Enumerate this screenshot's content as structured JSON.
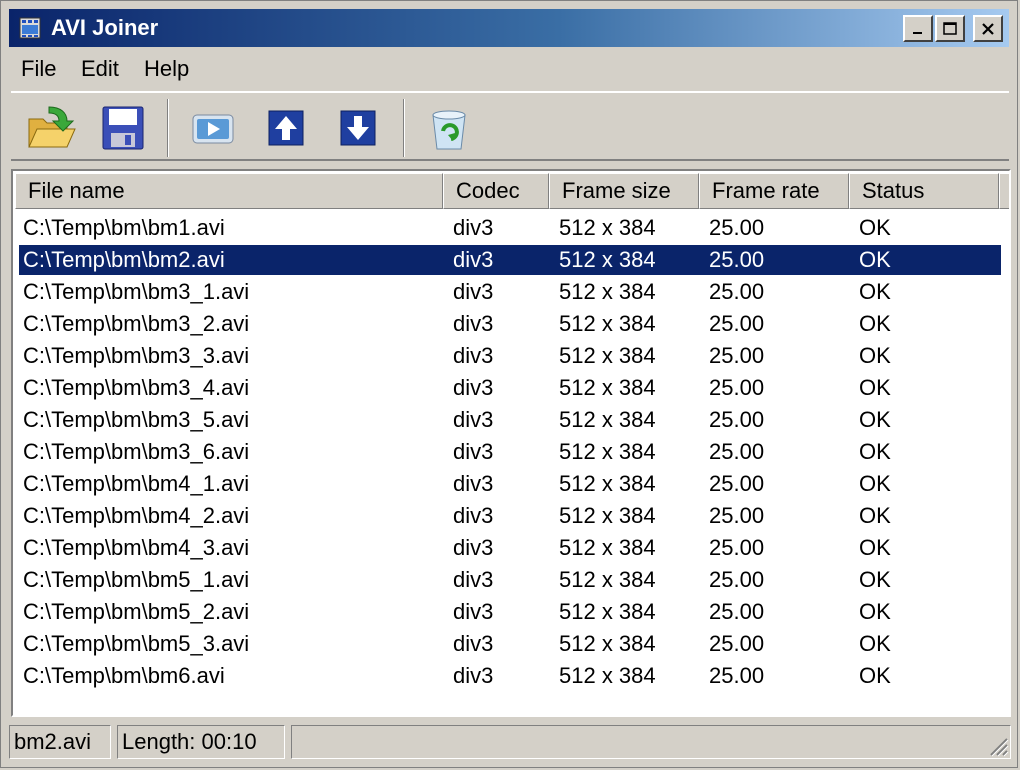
{
  "window": {
    "title": "AVI Joiner"
  },
  "menu": [
    {
      "label": "File"
    },
    {
      "label": "Edit"
    },
    {
      "label": "Help"
    }
  ],
  "toolbar": {
    "buttons": [
      {
        "icon": "open-folder-icon"
      },
      {
        "icon": "save-icon"
      },
      {
        "icon": "play-icon"
      },
      {
        "icon": "move-up-icon"
      },
      {
        "icon": "move-down-icon"
      },
      {
        "icon": "recycle-bin-icon"
      }
    ]
  },
  "list": {
    "columns": [
      "File name",
      "Codec",
      "Frame size",
      "Frame rate",
      "Status"
    ],
    "selected_index": 1,
    "rows": [
      {
        "name": "C:\\Temp\\bm\\bm1.avi",
        "codec": "div3",
        "size": "512 x 384",
        "rate": "25.00",
        "status": "OK"
      },
      {
        "name": "C:\\Temp\\bm\\bm2.avi",
        "codec": "div3",
        "size": "512 x 384",
        "rate": "25.00",
        "status": "OK"
      },
      {
        "name": "C:\\Temp\\bm\\bm3_1.avi",
        "codec": "div3",
        "size": "512 x 384",
        "rate": "25.00",
        "status": "OK"
      },
      {
        "name": "C:\\Temp\\bm\\bm3_2.avi",
        "codec": "div3",
        "size": "512 x 384",
        "rate": "25.00",
        "status": "OK"
      },
      {
        "name": "C:\\Temp\\bm\\bm3_3.avi",
        "codec": "div3",
        "size": "512 x 384",
        "rate": "25.00",
        "status": "OK"
      },
      {
        "name": "C:\\Temp\\bm\\bm3_4.avi",
        "codec": "div3",
        "size": "512 x 384",
        "rate": "25.00",
        "status": "OK"
      },
      {
        "name": "C:\\Temp\\bm\\bm3_5.avi",
        "codec": "div3",
        "size": "512 x 384",
        "rate": "25.00",
        "status": "OK"
      },
      {
        "name": "C:\\Temp\\bm\\bm3_6.avi",
        "codec": "div3",
        "size": "512 x 384",
        "rate": "25.00",
        "status": "OK"
      },
      {
        "name": "C:\\Temp\\bm\\bm4_1.avi",
        "codec": "div3",
        "size": "512 x 384",
        "rate": "25.00",
        "status": "OK"
      },
      {
        "name": "C:\\Temp\\bm\\bm4_2.avi",
        "codec": "div3",
        "size": "512 x 384",
        "rate": "25.00",
        "status": "OK"
      },
      {
        "name": "C:\\Temp\\bm\\bm4_3.avi",
        "codec": "div3",
        "size": "512 x 384",
        "rate": "25.00",
        "status": "OK"
      },
      {
        "name": "C:\\Temp\\bm\\bm5_1.avi",
        "codec": "div3",
        "size": "512 x 384",
        "rate": "25.00",
        "status": "OK"
      },
      {
        "name": "C:\\Temp\\bm\\bm5_2.avi",
        "codec": "div3",
        "size": "512 x 384",
        "rate": "25.00",
        "status": "OK"
      },
      {
        "name": "C:\\Temp\\bm\\bm5_3.avi",
        "codec": "div3",
        "size": "512 x 384",
        "rate": "25.00",
        "status": "OK"
      },
      {
        "name": "C:\\Temp\\bm\\bm6.avi",
        "codec": "div3",
        "size": "512 x 384",
        "rate": "25.00",
        "status": "OK"
      }
    ]
  },
  "statusbar": {
    "file": "bm2.avi",
    "length": "Length: 00:10"
  },
  "colors": {
    "titlebar_start": "#0a246a",
    "titlebar_end": "#a6caf0",
    "selection": "#0a246a",
    "face": "#d4d0c8"
  }
}
